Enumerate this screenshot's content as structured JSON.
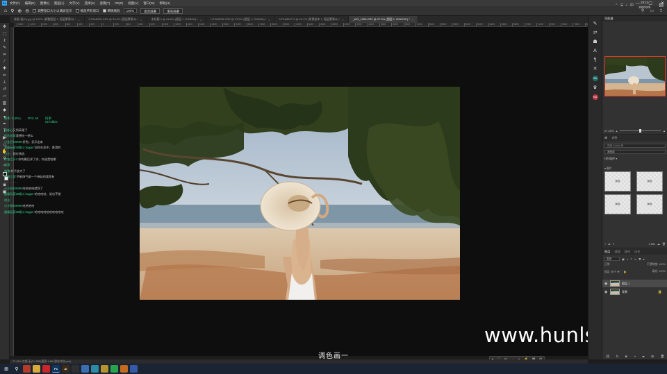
{
  "menubar": {
    "items": [
      "文件(F)",
      "编辑(E)",
      "图像(I)",
      "图层(L)",
      "文字(Y)",
      "选择(S)",
      "滤镜(T)",
      "3D(D)",
      "视图(V)",
      "窗口(W)",
      "帮助(H)"
    ]
  },
  "options": {
    "check1": "调整窗口大小以满屏显示",
    "check2": "缩放所有窗口",
    "check3": "细微缩放",
    "zoom_value": "100%",
    "fit_btn": "适合屏幕",
    "fill_btn": "填充屏幕"
  },
  "tabs": [
    {
      "label": "修图-春(C).jpg @ 100% (调整图层 1, 图层蒙版/8) *"
    },
    {
      "label": "UT3A8295.CR2 @ 33.6% (图层蒙版/8) *"
    },
    {
      "label": "未标题-1 @ 66.6% (图层 1, RGB/8#) *"
    },
    {
      "label": "UT3A8295.CR2 @ 73.5% (图层 1, RGB/8#) *"
    },
    {
      "label": "UT3A8297-3 @ 24.2% (背景副本 1, 图层蒙版/8) *"
    },
    {
      "label": "_MG_1953.CR2 @ 27.5% (图层 1, RGB/16*) *"
    }
  ],
  "ruler_ticks": [
    "1400",
    "1200",
    "1000",
    "800",
    "600",
    "400",
    "200",
    "0",
    "200",
    "400",
    "600",
    "800",
    "1000",
    "1200",
    "1400",
    "1600",
    "1800",
    "2000",
    "2200",
    "2400",
    "2600",
    "2800",
    "3000",
    "3200",
    "3400",
    "3600",
    "3800",
    "4000",
    "4200",
    "4400",
    "4600",
    "4800",
    "5000",
    "5200",
    "5400",
    "5600",
    "5800",
    "6000",
    "6200",
    "6400",
    "6600",
    "6800",
    "7000",
    "7200",
    "7400",
    "7600",
    "7800",
    "8000"
  ],
  "chat": {
    "fps_text": "帧率: 0 (0%)",
    "fps_value": "FPS: 60",
    "bitrate_label": "码率:",
    "bitrate_value": "6272kb/s",
    "lines": [
      {
        "user": "萌新心",
        "msg": "又到高潮了"
      },
      {
        "user": "钻石玩家",
        "msg": "我想吃一想么"
      },
      {
        "user": "小金豆8:9999:",
        "msg": "好啦，显示出来"
      },
      {
        "user": "超级玩家28格斗:logger:",
        "msg": "如何在家中，跌滑的"
      },
      {
        "user": "小小：",
        "msg": "现在挑选"
      },
      {
        "user": "宇宙之子1:",
        "msg": "你的最后求了求，你说是啥哪"
      },
      {
        "user": "风荷",
        "msg": ""
      },
      {
        "user": "独狼:",
        "msg": "片子放大了"
      },
      {
        "user": "大树之家:",
        "msg": "不能呀气能一个神仙的我家有"
      },
      {
        "user": "",
        "msg": "· · · · · · · ·"
      },
      {
        "user": "小小萌8:9999:",
        "msg": "哈哈哈哈就我了"
      },
      {
        "user": "超级玩家28格斗:logger:",
        "msg": "哈哈哈哈，说也不错"
      },
      {
        "user": "时光",
        "msg": ""
      },
      {
        "user": "小小萌8:9999:",
        "msg": "哈哈哈哈"
      },
      {
        "user": "超级玩家28格斗:logger:",
        "msg": "哈哈哈哈哈哈哈哈哈哈"
      }
    ]
  },
  "subtitle": "调色画一",
  "watermark": "www.hunls.com",
  "status_bar": "27.45%   文档:无(2.4 MB)/更多 4,88.(保存文档.psd)",
  "navigator": {
    "tab": "导航器",
    "zoom": "27.45%"
  },
  "library": {
    "tabs": [
      "库",
      "调整"
    ],
    "search_placeholder": "搜索 Adobe 库",
    "selected": "我的库",
    "row": "排列顺序 ▾",
    "group": "▾ 图片",
    "assets": [
      "画板",
      "画板",
      "画板",
      "画板"
    ],
    "size": "2 MB"
  },
  "layers": {
    "tabs": [
      "图层",
      "通道",
      "路径",
      "历史"
    ],
    "kind": "类型",
    "blend": "正常",
    "opacity_label": "不透明度:",
    "opacity_value": "100%",
    "lock_label": "锁定:",
    "fill_label": "填充:",
    "fill_value": "100%",
    "items": [
      {
        "name": "图层 1",
        "selected": true
      },
      {
        "name": "背景",
        "selected": false
      }
    ]
  },
  "taskbar": {
    "time": "23:13",
    "date": "2020/2/6",
    "lang": "中",
    "apps": [
      {
        "name": "search",
        "label": "",
        "color": "#b43a2a"
      },
      {
        "name": "chrome",
        "label": "",
        "color": "#d8a93a"
      },
      {
        "name": "red-app",
        "label": "",
        "color": "#c8262a"
      },
      {
        "name": "photoshop",
        "label": "Ps",
        "color": "#12355b"
      },
      {
        "name": "illustrator",
        "label": "Ai",
        "color": "#3a2a16"
      },
      {
        "name": "lr-app",
        "label": "",
        "color": "#2f2f2f"
      },
      {
        "name": "blue-app",
        "label": "",
        "color": "#3d6fb0"
      },
      {
        "name": "cyan-app",
        "label": "",
        "color": "#2e8aa5"
      },
      {
        "name": "yellow-app",
        "label": "",
        "color": "#b7942e"
      },
      {
        "name": "wechat",
        "label": "",
        "color": "#2aa44c"
      },
      {
        "name": "orange-app",
        "label": "",
        "color": "#c56a1e"
      },
      {
        "name": "word-app",
        "label": "",
        "color": "#365aa8"
      }
    ]
  }
}
